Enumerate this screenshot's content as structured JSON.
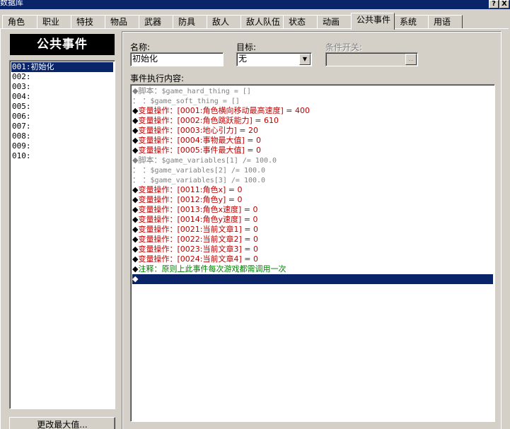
{
  "window": {
    "title": "数据库",
    "help_btn": "?",
    "close_btn": "X"
  },
  "tabs": [
    {
      "label": "角色"
    },
    {
      "label": "职业"
    },
    {
      "label": "特技"
    },
    {
      "label": "物品"
    },
    {
      "label": "武器"
    },
    {
      "label": "防具"
    },
    {
      "label": "敌人"
    },
    {
      "label": "敌人队伍"
    },
    {
      "label": "状态"
    },
    {
      "label": "动画"
    },
    {
      "label": "公共事件",
      "active": true
    },
    {
      "label": "系统"
    },
    {
      "label": "用语"
    }
  ],
  "left": {
    "header": "公共事件",
    "items": [
      {
        "label": "001:初始化",
        "selected": true
      },
      {
        "label": "002:"
      },
      {
        "label": "003:"
      },
      {
        "label": "004:"
      },
      {
        "label": "005:"
      },
      {
        "label": "006:"
      },
      {
        "label": "007:"
      },
      {
        "label": "008:"
      },
      {
        "label": "009:"
      },
      {
        "label": "010:"
      }
    ],
    "change_max_button": "更改最大值..."
  },
  "form": {
    "name_label": "名称:",
    "name_value": "初始化",
    "target_label": "目标:",
    "target_value": "无",
    "switch_label": "条件开关:",
    "switch_value": "",
    "switch_button": "...",
    "content_label": "事件执行内容:"
  },
  "commands": [
    {
      "type": "script",
      "prefix": "◆脚本：",
      "text": "$game_hard_thing = []"
    },
    {
      "type": "script",
      "prefix": "：    ：",
      "text": "$game_soft_thing = []"
    },
    {
      "type": "var",
      "prefix": "◆",
      "text": "变量操作：[0001:角色横向移动最高速度] = 400"
    },
    {
      "type": "var",
      "prefix": "◆",
      "text": "变量操作：[0002:角色跳跃能力] = 610"
    },
    {
      "type": "var",
      "prefix": "◆",
      "text": "变量操作：[0003:地心引力] = 20"
    },
    {
      "type": "var",
      "prefix": "◆",
      "text": "变量操作：[0004:事物最大值] = 0"
    },
    {
      "type": "var",
      "prefix": "◆",
      "text": "变量操作：[0005:事件最大值] = 0"
    },
    {
      "type": "script",
      "prefix": "◆脚本：",
      "text": "$game_variables[1] /= 100.0"
    },
    {
      "type": "script",
      "prefix": "：    ：",
      "text": "$game_variables[2] /= 100.0"
    },
    {
      "type": "script",
      "prefix": "：    ：",
      "text": "$game_variables[3] /= 100.0"
    },
    {
      "type": "var",
      "prefix": "◆",
      "text": "变量操作：[0011:角色x] = 0"
    },
    {
      "type": "var",
      "prefix": "◆",
      "text": "变量操作：[0012:角色y] = 0"
    },
    {
      "type": "var",
      "prefix": "◆",
      "text": "变量操作：[0013:角色x速度] = 0"
    },
    {
      "type": "var",
      "prefix": "◆",
      "text": "变量操作：[0014:角色y速度] = 0"
    },
    {
      "type": "var",
      "prefix": "◆",
      "text": "变量操作：[0021:当前文章1] = 0"
    },
    {
      "type": "var",
      "prefix": "◆",
      "text": "变量操作：[0022:当前文章2] = 0"
    },
    {
      "type": "var",
      "prefix": "◆",
      "text": "变量操作：[0023:当前文章3] = 0"
    },
    {
      "type": "var",
      "prefix": "◆",
      "text": "变量操作：[0024:当前文章4] = 0"
    },
    {
      "type": "note",
      "prefix": "◆",
      "text": "注释：原则上此事件每次游戏都需调用一次"
    },
    {
      "type": "empty",
      "prefix": "◆",
      "text": ""
    }
  ]
}
